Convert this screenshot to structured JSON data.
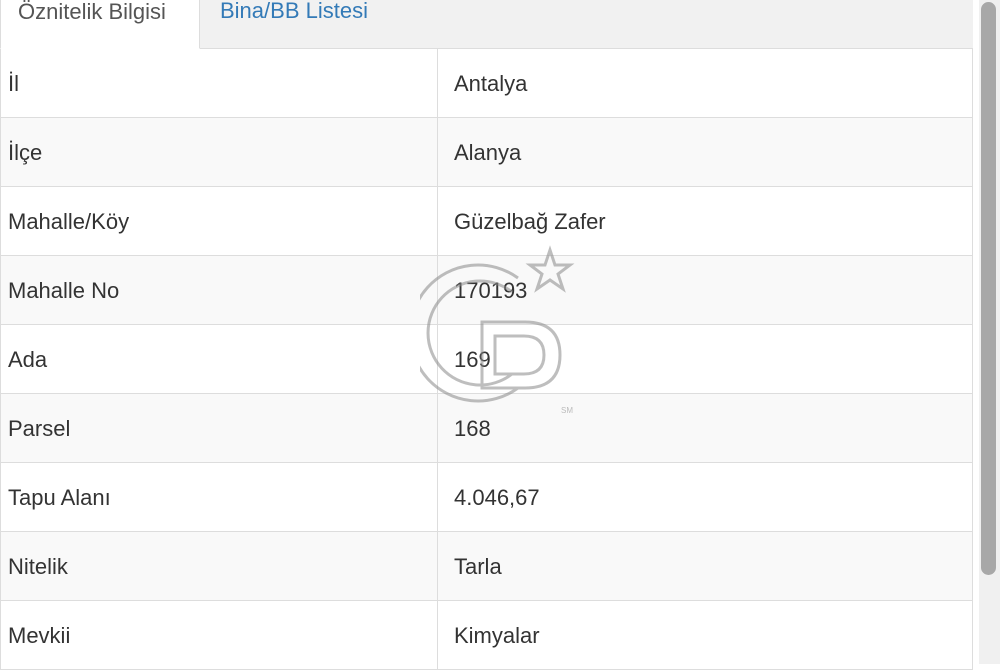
{
  "tabs": [
    {
      "label": "Öznitelik Bilgisi",
      "active": true
    },
    {
      "label": "Bina/BB Listesi",
      "active": false
    }
  ],
  "rows": [
    {
      "label": "İl",
      "value": "Antalya"
    },
    {
      "label": "İlçe",
      "value": "Alanya"
    },
    {
      "label": "Mahalle/Köy",
      "value": "Güzelbağ Zafer"
    },
    {
      "label": "Mahalle No",
      "value": "170193"
    },
    {
      "label": "Ada",
      "value": "169"
    },
    {
      "label": "Parsel",
      "value": "168"
    },
    {
      "label": "Tapu Alanı",
      "value": "4.046,67"
    },
    {
      "label": "Nitelik",
      "value": "Tarla"
    },
    {
      "label": "Mevkii",
      "value": "Kimyalar"
    }
  ],
  "watermark": {
    "text": "CB",
    "mark": "SM"
  },
  "colors": {
    "link": "#337ab7",
    "border": "#dddddd",
    "stripe": "#f9f9f9",
    "tabbar": "#f1f1f1"
  }
}
